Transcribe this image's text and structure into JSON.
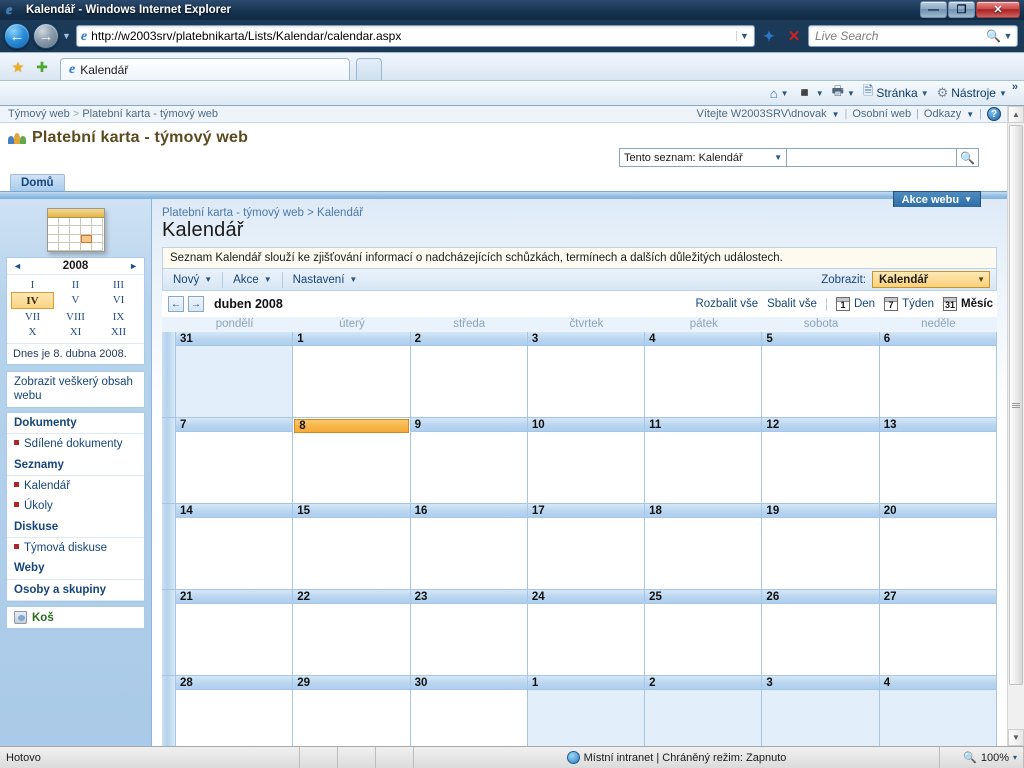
{
  "browser": {
    "window_title": "Kalendář - Windows Internet Explorer",
    "url": "http://w2003srv/platebnikarta/Lists/Kalendar/calendar.aspx",
    "search_placeholder": "Live Search",
    "tab_label": "Kalendář",
    "minimize_label": "—",
    "maximize_label": "❐",
    "close_label": "✕",
    "back_label": "←",
    "forward_label": "→",
    "refresh_label": "✦",
    "stop_label": "✕",
    "commands": [
      {
        "label": "",
        "icon": "home-icon"
      },
      {
        "label": "",
        "icon": "rss-icon"
      },
      {
        "label": "",
        "icon": "print-icon"
      },
      {
        "label": "Stránka",
        "icon": "page-icon"
      },
      {
        "label": "Nástroje",
        "icon": "gear-icon"
      }
    ],
    "overflow_label": "»"
  },
  "global_bar": {
    "breadcrumb_root": "Týmový web",
    "breadcrumb_sep": ">",
    "breadcrumb_current": "Platební karta - týmový web",
    "welcome": "Vítejte W2003SRV\\dnovak",
    "personal_site": "Osobní web",
    "links": "Odkazy",
    "help_label": "?"
  },
  "site": {
    "title": "Platební karta - týmový web",
    "nav_tabs": [
      {
        "label": "Domů"
      }
    ],
    "site_actions": "Akce webu",
    "search_scope": "Tento seznam: Kalendář",
    "search_value": "",
    "search_go_icon": "search-icon"
  },
  "left_nav": {
    "mini_calendar": {
      "prev_label": "◄",
      "year": "2008",
      "next_label": "►",
      "months": [
        "I",
        "II",
        "III",
        "IV",
        "V",
        "VI",
        "VII",
        "VIII",
        "IX",
        "X",
        "XI",
        "XII"
      ],
      "selected_month": "IV",
      "today_text": "Dnes je 8. dubna 2008."
    },
    "view_all": "Zobrazit veškerý obsah webu",
    "sections": [
      {
        "header": "Dokumenty",
        "items": [
          {
            "label": "Sdílené dokumenty"
          }
        ]
      },
      {
        "header": "Seznamy",
        "items": [
          {
            "label": "Kalendář"
          },
          {
            "label": "Úkoly"
          }
        ]
      },
      {
        "header": "Diskuse",
        "items": [
          {
            "label": "Týmová diskuse"
          }
        ]
      },
      {
        "header": "Weby",
        "items": []
      },
      {
        "header": "Osoby a skupiny",
        "items": []
      }
    ],
    "recycle_bin": "Koš"
  },
  "content": {
    "breadcrumb_parent": "Platební karta - týmový web",
    "breadcrumb_sep": ">",
    "breadcrumb_current": "Kalendář",
    "page_title": "Kalendář",
    "description": "Seznam Kalendář slouží ke zjišťování informací o nadcházejících schůzkách, termínech a dalších důležitých událostech.",
    "toolbar": {
      "new": "Nový",
      "actions": "Akce",
      "settings": "Nastavení",
      "view_label": "Zobrazit:",
      "view_value": "Kalendář"
    }
  },
  "calendar": {
    "prev_label": "←",
    "next_label": "→",
    "month_label": "duben 2008",
    "expand_all": "Rozbalit vše",
    "collapse_all": "Sbalit vše",
    "views": [
      {
        "label": "Den",
        "icon_num": "1",
        "active": false
      },
      {
        "label": "Týden",
        "icon_num": "7",
        "active": false
      },
      {
        "label": "Měsíc",
        "icon_num": "31",
        "active": true
      }
    ],
    "day_names": [
      "pondělí",
      "úterý",
      "středa",
      "čtvrtek",
      "pátek",
      "sobota",
      "neděle"
    ],
    "weeks": [
      [
        {
          "d": "31",
          "other": true
        },
        {
          "d": "1"
        },
        {
          "d": "2"
        },
        {
          "d": "3"
        },
        {
          "d": "4"
        },
        {
          "d": "5"
        },
        {
          "d": "6"
        }
      ],
      [
        {
          "d": "7"
        },
        {
          "d": "8",
          "today": true
        },
        {
          "d": "9"
        },
        {
          "d": "10"
        },
        {
          "d": "11"
        },
        {
          "d": "12"
        },
        {
          "d": "13"
        }
      ],
      [
        {
          "d": "14"
        },
        {
          "d": "15"
        },
        {
          "d": "16"
        },
        {
          "d": "17"
        },
        {
          "d": "18"
        },
        {
          "d": "19"
        },
        {
          "d": "20"
        }
      ],
      [
        {
          "d": "21"
        },
        {
          "d": "22"
        },
        {
          "d": "23"
        },
        {
          "d": "24"
        },
        {
          "d": "25"
        },
        {
          "d": "26"
        },
        {
          "d": "27"
        }
      ],
      [
        {
          "d": "28"
        },
        {
          "d": "29"
        },
        {
          "d": "30"
        },
        {
          "d": "1",
          "other": true
        },
        {
          "d": "2",
          "other": true
        },
        {
          "d": "3",
          "other": true
        },
        {
          "d": "4",
          "other": true
        }
      ]
    ]
  },
  "status_bar": {
    "message": "Hotovo",
    "zone": "Místní intranet | Chráněný režim: Zapnuto",
    "zoom": "100%",
    "zoom_caret": "▾"
  }
}
